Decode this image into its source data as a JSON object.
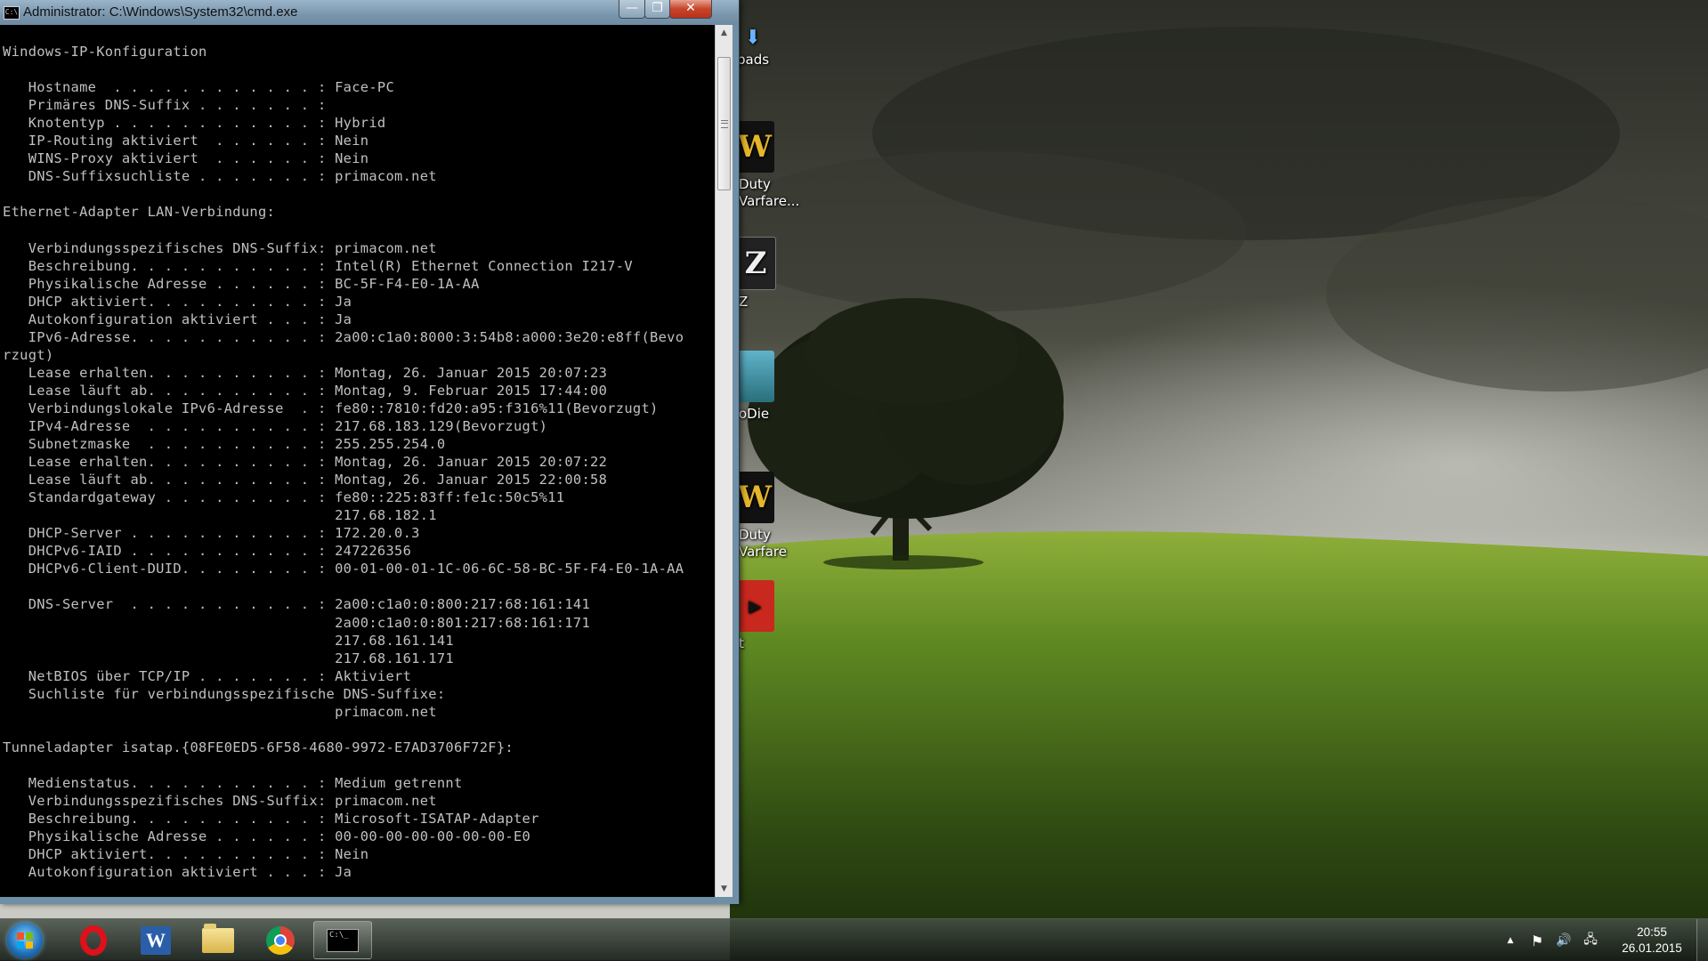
{
  "window": {
    "title": "Administrator: C:\\Windows\\System32\\cmd.exe",
    "icon_label": "C:\\",
    "buttons": {
      "minimize": "—",
      "maximize": "❐",
      "close": "✕"
    }
  },
  "console": {
    "lines": [
      "Windows-IP-Konfiguration",
      "",
      "   Hostname  . . . . . . . . . . . . : Face-PC",
      "   Primäres DNS-Suffix . . . . . . . :",
      "   Knotentyp . . . . . . . . . . . . : Hybrid",
      "   IP-Routing aktiviert  . . . . . . : Nein",
      "   WINS-Proxy aktiviert  . . . . . . : Nein",
      "   DNS-Suffixsuchliste . . . . . . . : primacom.net",
      "",
      "Ethernet-Adapter LAN-Verbindung:",
      "",
      "   Verbindungsspezifisches DNS-Suffix: primacom.net",
      "   Beschreibung. . . . . . . . . . . : Intel(R) Ethernet Connection I217-V",
      "   Physikalische Adresse . . . . . . : BC-5F-F4-E0-1A-AA",
      "   DHCP aktiviert. . . . . . . . . . : Ja",
      "   Autokonfiguration aktiviert . . . : Ja",
      "   IPv6-Adresse. . . . . . . . . . . : 2a00:c1a0:8000:3:54b8:a000:3e20:e8ff(Bevo",
      "rzugt)",
      "   Lease erhalten. . . . . . . . . . : Montag, 26. Januar 2015 20:07:23",
      "   Lease läuft ab. . . . . . . . . . : Montag, 9. Februar 2015 17:44:00",
      "   Verbindungslokale IPv6-Adresse  . : fe80::7810:fd20:a95:f316%11(Bevorzugt)",
      "   IPv4-Adresse  . . . . . . . . . . : 217.68.183.129(Bevorzugt)",
      "   Subnetzmaske  . . . . . . . . . . : 255.255.254.0",
      "   Lease erhalten. . . . . . . . . . : Montag, 26. Januar 2015 20:07:22",
      "   Lease läuft ab. . . . . . . . . . : Montag, 26. Januar 2015 22:00:58",
      "   Standardgateway . . . . . . . . . : fe80::225:83ff:fe1c:50c5%11",
      "                                       217.68.182.1",
      "   DHCP-Server . . . . . . . . . . . : 172.20.0.3",
      "   DHCPv6-IAID . . . . . . . . . . . : 247226356",
      "   DHCPv6-Client-DUID. . . . . . . . : 00-01-00-01-1C-06-6C-58-BC-5F-F4-E0-1A-AA",
      "",
      "   DNS-Server  . . . . . . . . . . . : 2a00:c1a0:0:800:217:68:161:141",
      "                                       2a00:c1a0:0:801:217:68:161:171",
      "                                       217.68.161.141",
      "                                       217.68.161.171",
      "   NetBIOS über TCP/IP . . . . . . . : Aktiviert",
      "   Suchliste für verbindungsspezifische DNS-Suffixe:",
      "                                       primacom.net",
      "",
      "Tunneladapter isatap.{08FE0ED5-6F58-4680-9972-E7AD3706F72F}:",
      "",
      "   Medienstatus. . . . . . . . . . . : Medium getrennt",
      "   Verbindungsspezifisches DNS-Suffix: primacom.net",
      "   Beschreibung. . . . . . . . . . . : Microsoft-ISATAP-Adapter",
      "   Physikalische Adresse . . . . . . : 00-00-00-00-00-00-00-E0",
      "   DHCP aktiviert. . . . . . . . . . : Nein",
      "   Autokonfiguration aktiviert . . . : Ja"
    ]
  },
  "scrollbar": {
    "up_arrow": "▲",
    "down_arrow": "▼"
  },
  "desktop_icons": [
    {
      "label": "pads",
      "glyph": ""
    },
    {
      "label": "Duty\nVarfare...",
      "glyph": "W"
    },
    {
      "label": "Z",
      "glyph": "Z"
    },
    {
      "label": "oDie",
      "glyph": ""
    },
    {
      "label": "Duty\nVarfare",
      "glyph": "W"
    },
    {
      "label": "t",
      "glyph": "▶"
    }
  ],
  "taskbar": {
    "apps": [
      {
        "name": "Opera",
        "state": "pinned"
      },
      {
        "name": "Microsoft Word",
        "glyph": "W",
        "state": "pinned"
      },
      {
        "name": "Windows Explorer",
        "state": "pinned"
      },
      {
        "name": "Google Chrome",
        "state": "pinned"
      },
      {
        "name": "Eingabeaufforderung",
        "glyph": "C:\\_",
        "state": "running"
      }
    ],
    "tray_icons": [
      "chevron-up-icon",
      "flag-icon",
      "speaker-icon",
      "network-icon"
    ],
    "tray_glyphs": {
      "chevron": "▲",
      "flag": "⚑",
      "speaker": "🔊",
      "network": "🖧"
    },
    "clock": {
      "time": "20:55",
      "date": "26.01.2015"
    }
  },
  "colors": {
    "console_bg": "#000000",
    "console_fg": "#C0C0C0",
    "titlebar": "#7996AD",
    "close_button": "#C7442A",
    "opera_red": "#E0101A",
    "word_blue": "#2A5EA8"
  }
}
